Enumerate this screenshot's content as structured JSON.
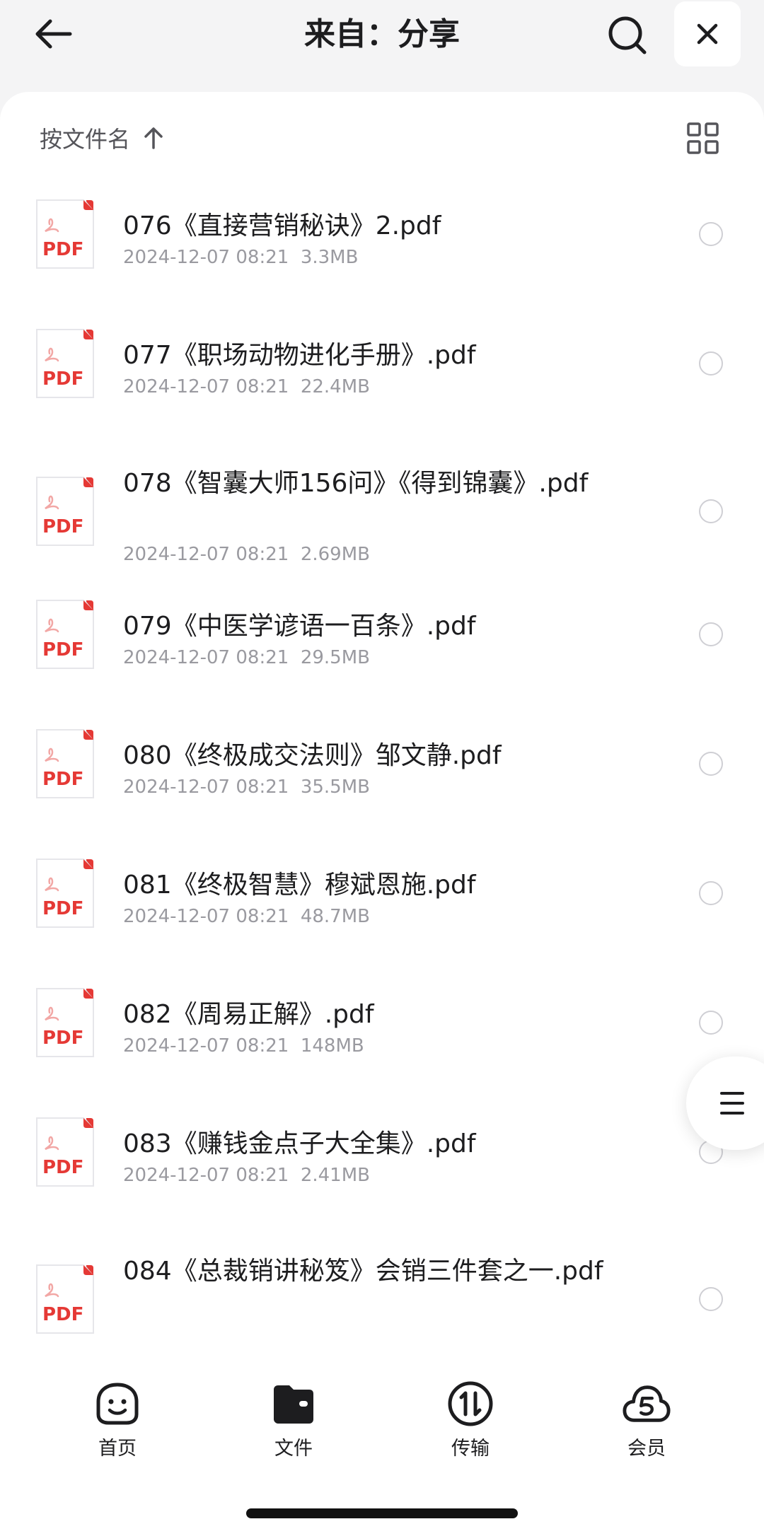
{
  "header": {
    "title": "来自：分享"
  },
  "sort": {
    "label": "按文件名"
  },
  "files": [
    {
      "name": "076《直接营销秘诀》2.pdf",
      "date": "2024-12-07 08:21",
      "size": "3.3MB",
      "icon_label": "PDF"
    },
    {
      "name": "077《职场动物进化手册》.pdf",
      "date": "2024-12-07 08:21",
      "size": "22.4MB",
      "icon_label": "PDF"
    },
    {
      "name": "078《智囊大师156问》《得到锦囊》.pdf",
      "date": "2024-12-07 08:21",
      "size": "2.69MB",
      "icon_label": "PDF"
    },
    {
      "name": "079《中医学谚语一百条》.pdf",
      "date": "2024-12-07 08:21",
      "size": "29.5MB",
      "icon_label": "PDF"
    },
    {
      "name": "080《终极成交法则》邹文静.pdf",
      "date": "2024-12-07 08:21",
      "size": "35.5MB",
      "icon_label": "PDF"
    },
    {
      "name": "081《终极智慧》穆斌恩施.pdf",
      "date": "2024-12-07 08:21",
      "size": "48.7MB",
      "icon_label": "PDF"
    },
    {
      "name": "082《周易正解》.pdf",
      "date": "2024-12-07 08:21",
      "size": "148MB",
      "icon_label": "PDF"
    },
    {
      "name": "083《赚钱金点子大全集》.pdf",
      "date": "2024-12-07 08:21",
      "size": "2.41MB",
      "icon_label": "PDF"
    },
    {
      "name": "084《总裁销讲秘笈》会销三件套之一.pdf",
      "date": "",
      "size": "",
      "icon_label": "PDF"
    }
  ],
  "nav": {
    "items": [
      {
        "label": "首页",
        "icon": "smile-face-icon"
      },
      {
        "label": "文件",
        "icon": "folder-icon"
      },
      {
        "label": "传输",
        "icon": "transfer-icon"
      },
      {
        "label": "会员",
        "icon": "cloud-icon"
      }
    ],
    "active_index": 1
  },
  "colors": {
    "pdf_red": "#e53935",
    "text_primary": "#1d1d1f",
    "text_secondary": "#9a9aa0"
  }
}
